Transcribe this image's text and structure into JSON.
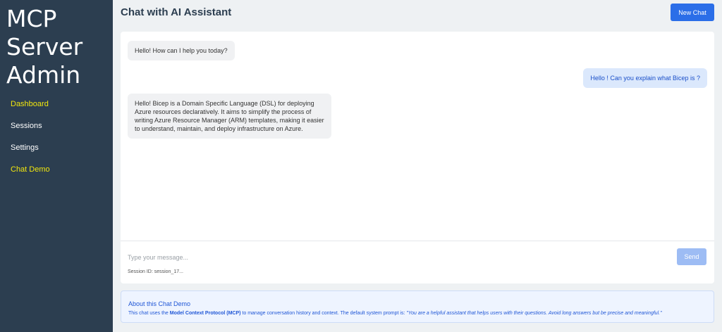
{
  "sidebar": {
    "brand": [
      "MCP",
      "Server",
      "Admin"
    ],
    "items": [
      {
        "label": "Dashboard",
        "active": true
      },
      {
        "label": "Sessions",
        "active": false
      },
      {
        "label": "Settings",
        "active": false
      },
      {
        "label": "Chat Demo",
        "active": true
      }
    ]
  },
  "header": {
    "title": "Chat with AI Assistant",
    "new_chat_label": "New Chat"
  },
  "chat": {
    "messages": [
      {
        "role": "assistant",
        "text": "Hello! How can I help you today?"
      },
      {
        "role": "user",
        "text": "Hello ! Can you explain what Bicep is ?"
      },
      {
        "role": "assistant",
        "lines": [
          "Hello! Bicep is a Domain Specific Language (DSL) for deploying",
          "Azure resources declaratively. It aims to simplify the process of",
          "writing Azure Resource Manager (ARM) templates, making it easier",
          "to understand, maintain, and deploy infrastructure on Azure."
        ]
      }
    ],
    "input_placeholder": "Type your message...",
    "input_value": "",
    "send_label": "Send",
    "session_label": "Session ID: session_17..."
  },
  "about": {
    "title": "About this Chat Demo",
    "text_prefix": "This chat uses the ",
    "protocol": "Model Context Protocol (MCP)",
    "text_middle": " to manage conversation history and context. The default system prompt is: ",
    "system_prompt": "\"You are a helpful assistant that helps users with their questions. Avoid long answers but be precise and meaningful.\""
  },
  "colors": {
    "sidebar_bg": "#2c3e50",
    "accent": "#2b6ee8",
    "active_nav": "#f1e60e"
  }
}
